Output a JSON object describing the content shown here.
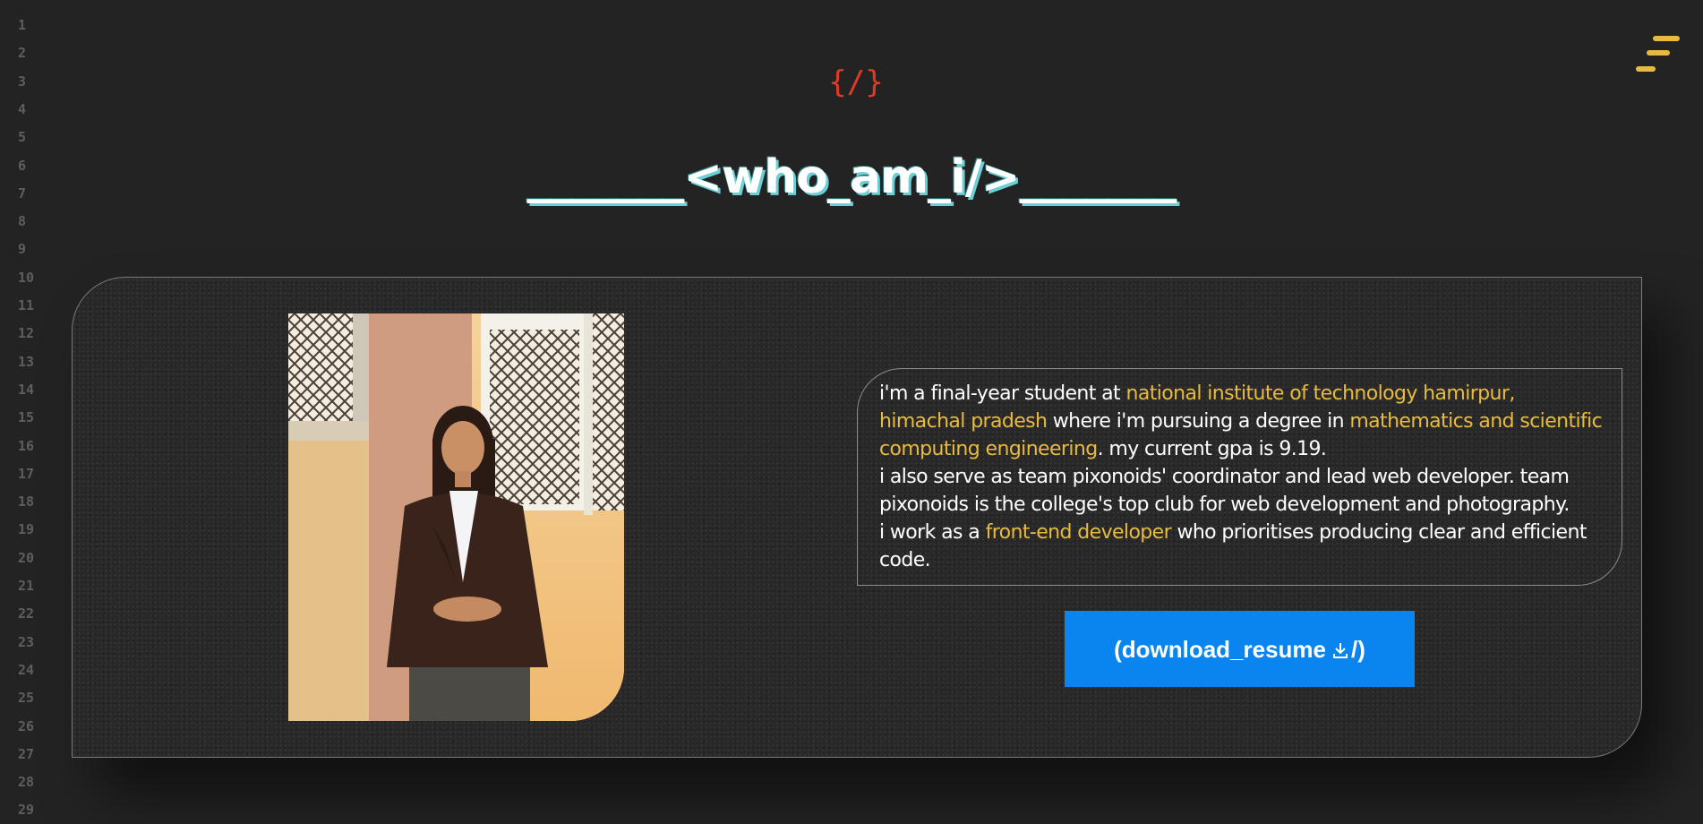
{
  "line_numbers": [
    "1",
    "2",
    "3",
    "4",
    "5",
    "6",
    "7",
    "8",
    "9",
    "10",
    "11",
    "12",
    "13",
    "14",
    "15",
    "16",
    "17",
    "18",
    "19",
    "20",
    "21",
    "22",
    "23",
    "24",
    "25",
    "26",
    "27",
    "28",
    "29"
  ],
  "code_symbol": "{/}",
  "heading": "_______<who_am_i/>_______",
  "bio": {
    "p1_a": "i'm a final-year student at ",
    "p1_hl1": "national institute of technology hamirpur, himachal pradesh",
    "p1_b": " where i'm pursuing a degree in ",
    "p1_hl2": "mathematics and scientific computing engineering",
    "p1_c": ". my current gpa is 9.19.",
    "p2": "i also serve as team pixonoids' coordinator and lead web developer. team pixonoids is the college's top club for web development and photography.",
    "p3_a": "i work as a ",
    "p3_hl": "front-end developer",
    "p3_b": " who prioritises producing clear and efficient code."
  },
  "download_button": {
    "label_start": "(download_resume",
    "label_end": "/)",
    "icon": "download-icon"
  },
  "menu_icon": "hamburger-menu-icon",
  "colors": {
    "background": "#232323",
    "accent_yellow": "#e8bb3e",
    "accent_red": "#dd3b29",
    "button_blue": "#0a85f0",
    "heading_shadow": "#6ccfd6"
  }
}
